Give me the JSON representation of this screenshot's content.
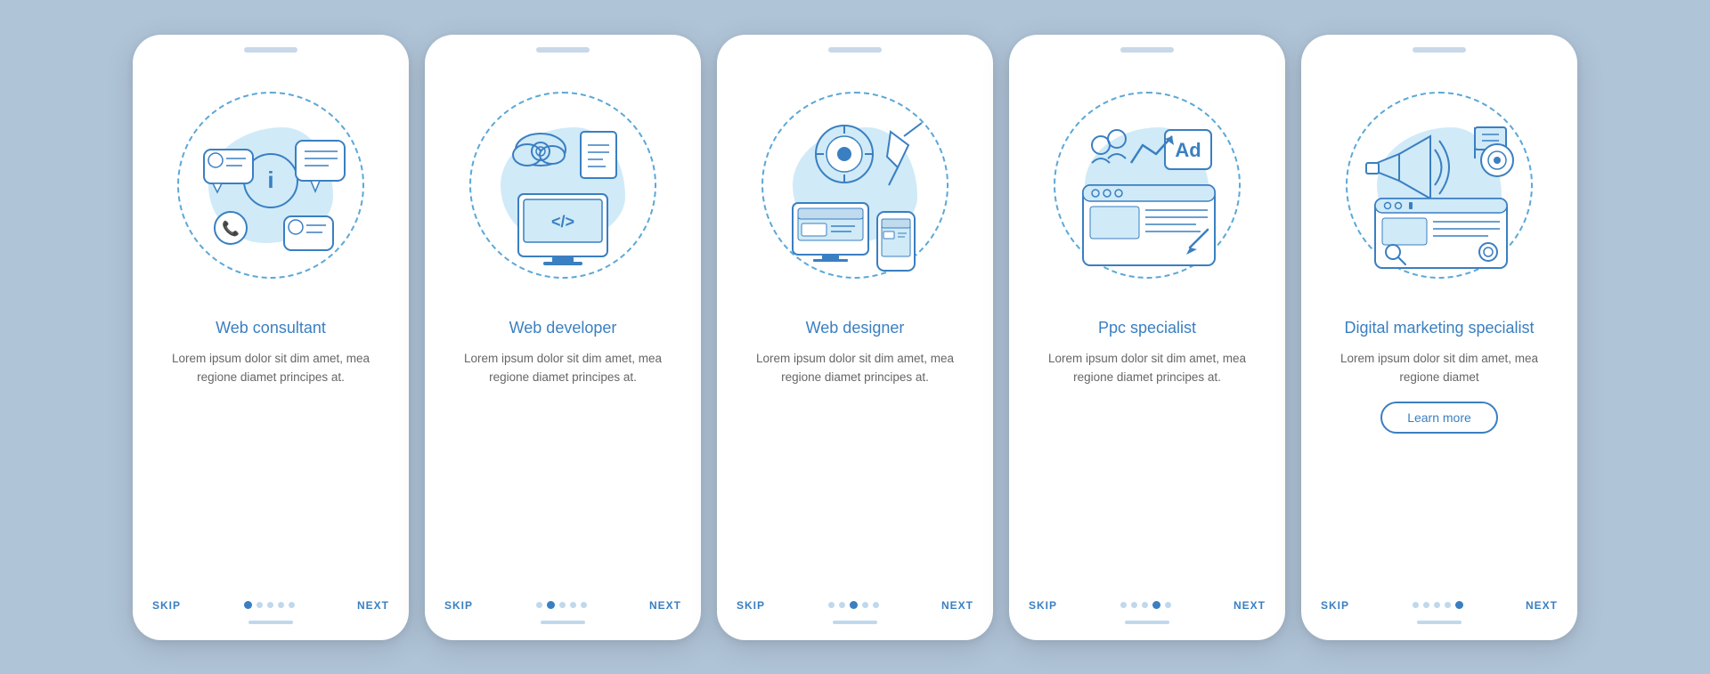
{
  "cards": [
    {
      "id": "web-consultant",
      "title": "Web consultant",
      "description": "Lorem ipsum dolor sit dim amet, mea regione diamet principes at.",
      "hasLearnMore": false,
      "activeDot": 0,
      "totalDots": 5,
      "nav": {
        "skip": "SKIP",
        "next": "NEXT"
      }
    },
    {
      "id": "web-developer",
      "title": "Web developer",
      "description": "Lorem ipsum dolor sit dim amet, mea regione diamet principes at.",
      "hasLearnMore": false,
      "activeDot": 1,
      "totalDots": 5,
      "nav": {
        "skip": "SKIP",
        "next": "NEXT"
      }
    },
    {
      "id": "web-designer",
      "title": "Web designer",
      "description": "Lorem ipsum dolor sit dim amet, mea regione diamet principes at.",
      "hasLearnMore": false,
      "activeDot": 2,
      "totalDots": 5,
      "nav": {
        "skip": "SKIP",
        "next": "NEXT"
      }
    },
    {
      "id": "ppc-specialist",
      "title": "Ppc specialist",
      "description": "Lorem ipsum dolor sit dim amet, mea regione diamet principes at.",
      "hasLearnMore": false,
      "activeDot": 3,
      "totalDots": 5,
      "nav": {
        "skip": "SKIP",
        "next": "NEXT"
      }
    },
    {
      "id": "digital-marketing-specialist",
      "title": "Digital marketing specialist",
      "description": "Lorem ipsum dolor sit dim amet, mea regione diamet",
      "hasLearnMore": true,
      "learnMoreLabel": "Learn more",
      "activeDot": 4,
      "totalDots": 5,
      "nav": {
        "skip": "SKIP",
        "next": "NEXT"
      }
    }
  ]
}
